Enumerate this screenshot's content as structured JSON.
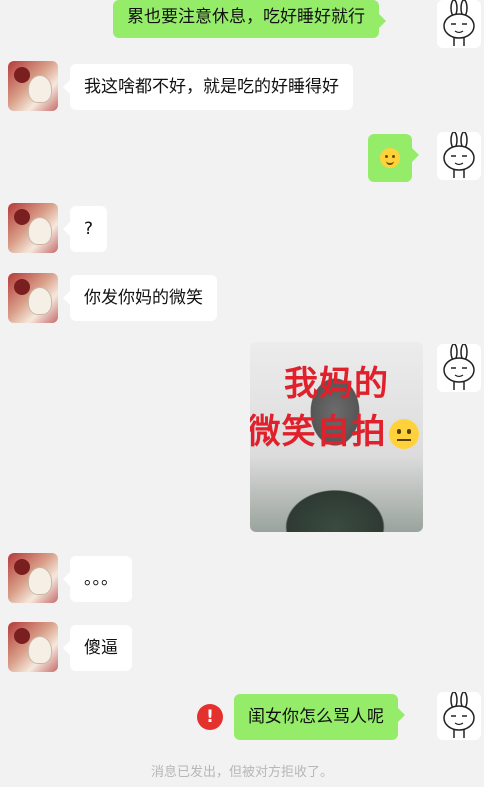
{
  "messages": [
    {
      "side": "right",
      "text": "累也要注意休息，吃好睡好就行"
    },
    {
      "side": "left",
      "text": "我这啥都不好，就是吃的好睡得好"
    },
    {
      "side": "right",
      "type": "emoji",
      "emoji": "smile-emoji"
    },
    {
      "side": "left",
      "text": "?"
    },
    {
      "side": "left",
      "text": "你发你妈的微笑"
    },
    {
      "side": "right",
      "type": "image",
      "caption_line1": "我妈的",
      "caption_line2": "微笑自拍",
      "emoji": "neutral-face-emoji"
    },
    {
      "side": "left",
      "text": "。。。"
    },
    {
      "side": "left",
      "text": "傻逼"
    },
    {
      "side": "right",
      "text": "闺女你怎么骂人呢",
      "status": "failed",
      "status_icon": "!"
    }
  ],
  "system_notice": "消息已发出，但被对方拒收了。",
  "colors": {
    "sent_bubble": "#95ec69",
    "received_bubble": "#ffffff",
    "background": "#f2f2f2",
    "error": "#e5312e"
  }
}
